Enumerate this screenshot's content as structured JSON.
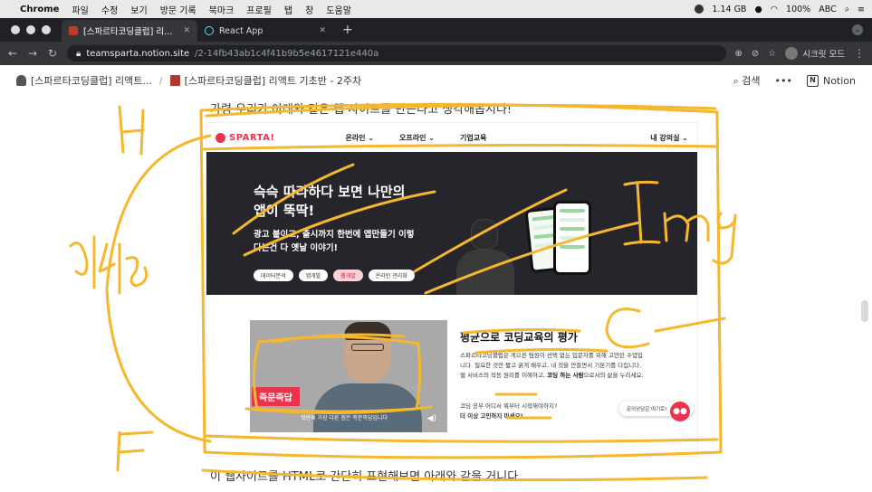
{
  "macbar": {
    "app": "Chrome",
    "menus": [
      "파일",
      "수정",
      "보기",
      "방문 기록",
      "북마크",
      "프로필",
      "탭",
      "창",
      "도움말"
    ],
    "memory": "1.14 GB",
    "battery": "100%",
    "input": "ABC"
  },
  "tabs": [
    {
      "title": "[스파르타코딩클럽] 리액트 기초반 - 2주차",
      "active": true
    },
    {
      "title": "React App",
      "active": false
    }
  ],
  "address": {
    "host": "teamsparta.notion.site",
    "path": "/2-14fb43ab1c4f41b9b5e4617121e440a",
    "profile": "시크릿 모드"
  },
  "notion": {
    "crumb1": "[스파르타코딩클럽] 리액트...",
    "crumb2": "[스파르타코딩클럽] 리액트 기초반 - 2주차",
    "search": "검색",
    "more": "•••",
    "app": "Notion"
  },
  "page": {
    "intro": "가령 우리가 아래와 같은 웹 사이트를 만든다고 생각해봅시다!",
    "outro": "이 웹사이트를 HTML로 간단히 표현해보면 아래와 같을 거니다."
  },
  "site": {
    "logo": "SPARTA!",
    "nav": [
      "온라인 ⌄",
      "오프라인 ⌄",
      "기업교육"
    ],
    "nav_right": "내 강의실 ⌄",
    "hero_title": "슥슥 따라하다 보면 나만의 앱이 뚝딱!",
    "hero_sub": "광고 붙이고, 출시까지 한번에 앱만들기 이렇다는건 다 옛날 이야기!",
    "pills": [
      "데이터분석",
      "앱개발",
      "웹개발",
      "온라인 관리화"
    ],
    "video_badge": "즉문즉답",
    "video_caption": "첫번째 가장 다른 점은 즉문즉답입니다",
    "review_title": "평균으로 코딩교육의 평가",
    "review_body": "스파르타코딩클럽은 게으른 팀원이 선택 없는 입문자를 위해 고안된 수업입니다. 필요한 것만 짧고 굵게 배우고, 내 것을 만들면서 기본기를 다집니다. 웹 서비스의 작동 원리를 이해하고,",
    "review_bold": "코딩 하는 사람",
    "review_tail": "으로서의 삶을 누리세요.",
    "question": "코딩 공부 어디서 뭐부터 시작해야하지?",
    "question_bold": "더 이상 고민하지 마세요!",
    "chat": "문의상담은 여기로!"
  },
  "annotations": {
    "letter_h": "H",
    "letter_f": "F",
    "word_nav": "내비",
    "word_img": "Img",
    "letter_c": "C"
  },
  "colors": {
    "brand": "#e8344e",
    "annotation": "#f5b72e"
  }
}
